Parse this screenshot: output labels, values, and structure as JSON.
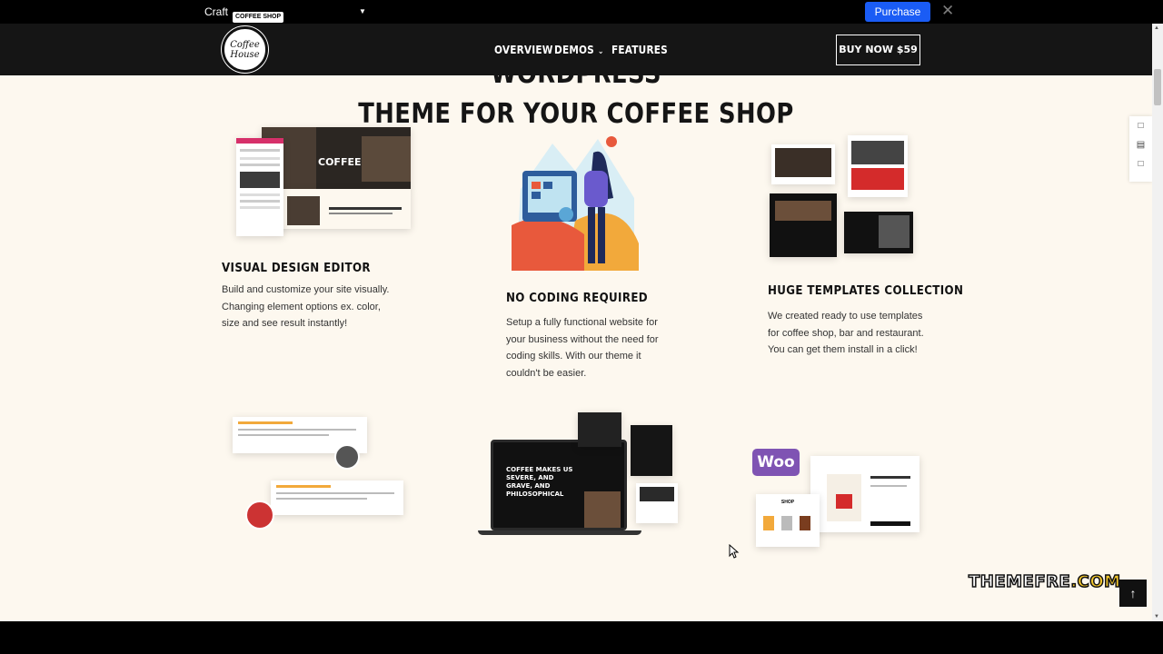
{
  "demo_bar": {
    "brand": "Craft",
    "theme_selected": "COFFEE SHOP",
    "purchase_label": "Purchase",
    "close_symbol": "✕"
  },
  "header": {
    "logo_text": "Coffee\nHouse",
    "nav": [
      "OVERVIEW",
      "DEMOS",
      "FEATURES"
    ],
    "demos_chevron": "⌄",
    "buy_label": "BUY NOW $59"
  },
  "hero": {
    "title_line1": "STAND OUT WITH A PROFESSIONAL WORDPRESS",
    "title_line2": "THEME FOR YOUR COFFEE SHOP"
  },
  "features": [
    {
      "title": "VISUAL DESIGN EDITOR",
      "text": "Build and customize your site visually. Changing element options ex. color, size and see result instantly!"
    },
    {
      "title": "NO CODING REQUIRED",
      "text": "Setup a fully functional website for your business without the need for coding skills. With our theme it couldn't be easier."
    },
    {
      "title": "HUGE TEMPLATES COLLECTION",
      "text": "We created ready to use templates for coffee shop, bar and restaurant. You can get them install in a click!"
    }
  ],
  "illustrations": {
    "editor_coffee": "COFFEE",
    "laptop_headline": "COFFEE MAKES US SEVERE, AND GRAVE, AND PHILOSOPHICAL",
    "woo_logo": "Woo",
    "shop_label": "SHOP"
  },
  "watermark": {
    "main": "THEMEFRE",
    "dot": ".COM"
  },
  "to_top": "↑",
  "colors": {
    "accent": "#1a5cf5",
    "background": "#fdf8ef",
    "dark": "#151515",
    "woo": "#7f54b3"
  }
}
